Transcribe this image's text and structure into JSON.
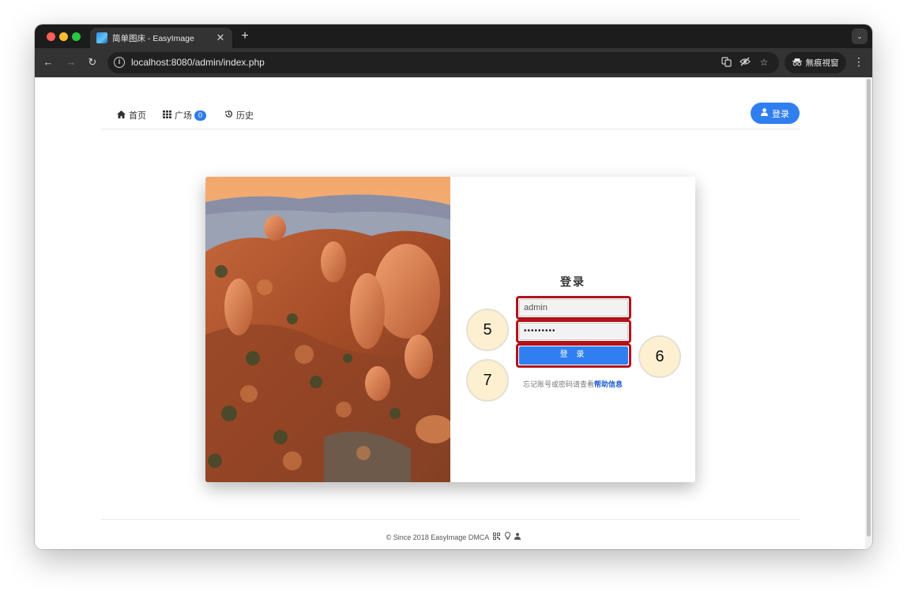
{
  "browser": {
    "tab_title": "简单图床 - EasyImage",
    "tab_close": "✕",
    "new_tab": "+",
    "url": "localhost:8080/admin/index.php",
    "incognito_label": "無痕視窗",
    "icons": {
      "back": "arrow-left-icon",
      "forward": "arrow-right-icon",
      "reload": "reload-icon",
      "info": "info-icon",
      "translate": "translate-icon",
      "eye_off": "eye-off-icon",
      "star": "star-icon",
      "incognito": "incognito-icon",
      "menu": "kebab-menu-icon"
    }
  },
  "nav": {
    "home": "首页",
    "square": "广场",
    "square_badge": "0",
    "history": "历史",
    "login": "登录"
  },
  "login_form": {
    "title": "登录",
    "username_value": "admin",
    "password_value": "•••••••••",
    "submit_label": "登 录",
    "forgot_text": "忘记账号或密码请查看",
    "forgot_link": "帮助信息"
  },
  "callouts": {
    "username": "5",
    "password": "6",
    "submit": "7"
  },
  "footer": {
    "text": "© Since 2018 EasyImage DMCA"
  },
  "colors": {
    "accent": "#2f7ff0",
    "highlight_border": "#b3121b",
    "callout_fill": "#fcf0d0"
  }
}
